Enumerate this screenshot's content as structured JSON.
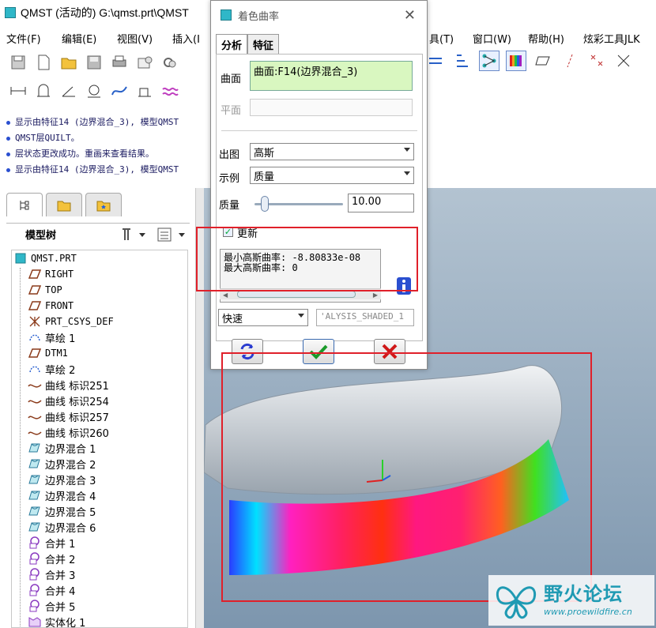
{
  "window": {
    "title": "QMST (活动的) G:\\qmst.prt\\QMST"
  },
  "menu": {
    "items": [
      "文件(F)",
      "编辑(E)",
      "视图(V)",
      "插入(I",
      "具(T)",
      "窗口(W)",
      "帮助(H)",
      "炫彩工具JLK"
    ]
  },
  "messages": [
    "显示由特征14 (边界混合_3), 模型QMST",
    "QMST层QUILT。",
    "层状态更改成功。重画来查看结果。",
    "显示由特征14 (边界混合_3), 模型QMST"
  ],
  "tree": {
    "header": "模型树",
    "root": "QMST.PRT",
    "items": [
      {
        "label": "RIGHT",
        "icon": "datum-plane-icon"
      },
      {
        "label": "TOP",
        "icon": "datum-plane-icon"
      },
      {
        "label": "FRONT",
        "icon": "datum-plane-icon"
      },
      {
        "label": "PRT_CSYS_DEF",
        "icon": "csys-icon"
      },
      {
        "label": "草绘 1",
        "icon": "sketch-icon"
      },
      {
        "label": "DTM1",
        "icon": "datum-plane-icon"
      },
      {
        "label": "草绘 2",
        "icon": "sketch-icon"
      },
      {
        "label": "曲线 标识251",
        "icon": "curve-icon"
      },
      {
        "label": "曲线 标识254",
        "icon": "curve-icon"
      },
      {
        "label": "曲线 标识257",
        "icon": "curve-icon"
      },
      {
        "label": "曲线 标识260",
        "icon": "curve-icon"
      },
      {
        "label": "边界混合 1",
        "icon": "boundary-blend-icon"
      },
      {
        "label": "边界混合 2",
        "icon": "boundary-blend-icon"
      },
      {
        "label": "边界混合 3",
        "icon": "boundary-blend-icon"
      },
      {
        "label": "边界混合 4",
        "icon": "boundary-blend-icon"
      },
      {
        "label": "边界混合 5",
        "icon": "boundary-blend-icon"
      },
      {
        "label": "边界混合 6",
        "icon": "boundary-blend-icon"
      },
      {
        "label": "合并 1",
        "icon": "merge-icon"
      },
      {
        "label": "合并 2",
        "icon": "merge-icon"
      },
      {
        "label": "合并 3",
        "icon": "merge-icon"
      },
      {
        "label": "合并 4",
        "icon": "merge-icon"
      },
      {
        "label": "合并 5",
        "icon": "merge-icon"
      },
      {
        "label": "实体化 1",
        "icon": "solidify-icon"
      }
    ]
  },
  "dialog": {
    "title": "着色曲率",
    "tabs": [
      "分析",
      "特征"
    ],
    "surface_label": "曲面",
    "surface_value": "曲面:F14(边界混合_3)",
    "plane_label": "平面",
    "output_label": "出图",
    "output_value": "高斯",
    "example_label": "示例",
    "example_value": "质量",
    "quality_label": "质量",
    "quality_value": "10.00",
    "update_label": "更新",
    "result_min": "最小高斯曲率: -8.80833e-08",
    "result_max": "最大高斯曲率: 0",
    "mode_value": "快速",
    "name_value": "'ALYSIS_SHADED_1",
    "quality_fraction": 0.12
  },
  "colors": {
    "accent_red": "#e0202a",
    "watermark": "#1f9ab3"
  },
  "watermark": {
    "title": "野火论坛",
    "url": "www.proewildfire.cn"
  }
}
